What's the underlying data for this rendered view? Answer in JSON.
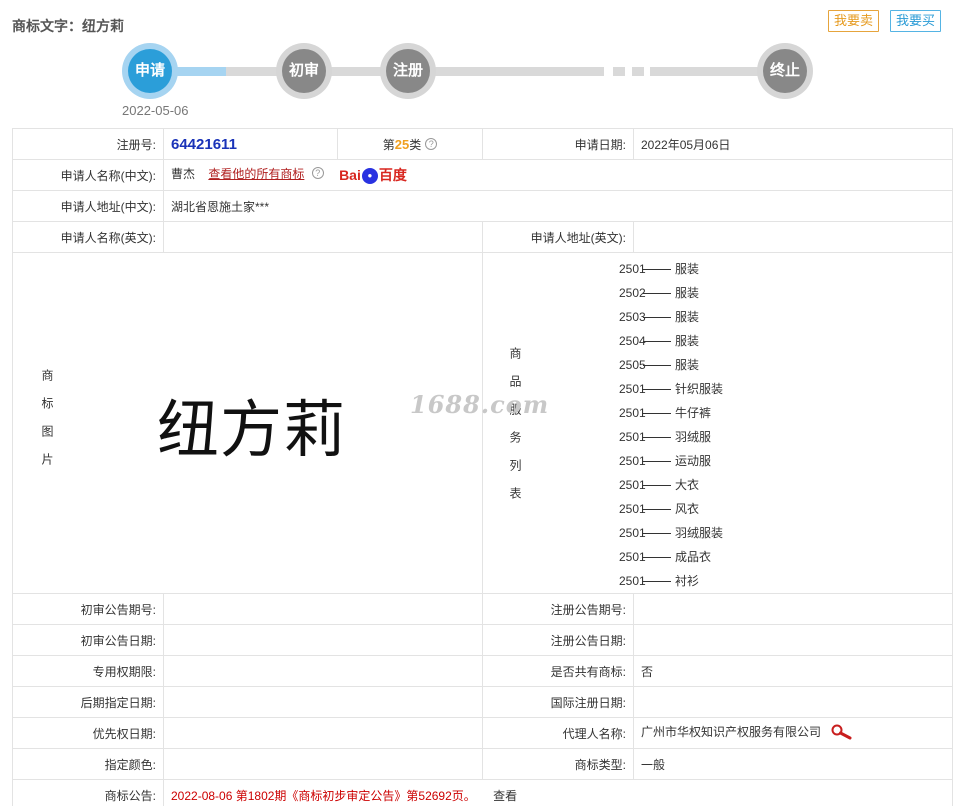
{
  "header": {
    "title": "商标文字：纽方莉",
    "sell_button": "我要卖",
    "buy_button": "我要买"
  },
  "progress": {
    "steps": [
      "申请",
      "初审",
      "注册",
      "终止"
    ],
    "active_step": 0,
    "apply_date": "2022-05-06",
    "colors": {
      "active": "#2b9ed9",
      "inactive": "#888888",
      "active_track": "#a6d4f1"
    }
  },
  "table": {
    "reg_no_label": "注册号:",
    "reg_no": "64421611",
    "class_prefix": "第",
    "class_num": "25",
    "class_suffix": "类",
    "apply_date_label": "申请日期:",
    "apply_date": "2022年05月06日",
    "applicant_cn_label": "申请人名称(中文):",
    "applicant_cn": "曹杰",
    "all_marks_link": "查看他的所有商标",
    "baidu_logo": "Bai百度",
    "address_cn_label": "申请人地址(中文):",
    "address_cn": "湖北省恩施土家***",
    "applicant_en_label": "申请人名称(英文):",
    "applicant_en": "",
    "address_en_label": "申请人地址(英文):",
    "address_en": "",
    "mark_image_label": "商标图片",
    "mark_image_text": "纽方莉",
    "watermark": "1688.com",
    "services_label": "商品服务列表",
    "services": [
      {
        "code": "2501",
        "name": "服装"
      },
      {
        "code": "2502",
        "name": "服装"
      },
      {
        "code": "2503",
        "name": "服装"
      },
      {
        "code": "2504",
        "name": "服装"
      },
      {
        "code": "2505",
        "name": "服装"
      },
      {
        "code": "2501",
        "name": "针织服装"
      },
      {
        "code": "2501",
        "name": "牛仔裤"
      },
      {
        "code": "2501",
        "name": "羽绒服"
      },
      {
        "code": "2501",
        "name": "运动服"
      },
      {
        "code": "2501",
        "name": "大衣"
      },
      {
        "code": "2501",
        "name": "风衣"
      },
      {
        "code": "2501",
        "name": "羽绒服装"
      },
      {
        "code": "2501",
        "name": "成品衣"
      },
      {
        "code": "2501",
        "name": "衬衫"
      }
    ],
    "prelim_no_label": "初审公告期号:",
    "prelim_no": "",
    "reg_notice_no_label": "注册公告期号:",
    "reg_notice_no": "",
    "prelim_date_label": "初审公告日期:",
    "prelim_date": "",
    "reg_notice_date_label": "注册公告日期:",
    "reg_notice_date": "",
    "exclusive_period_label": "专用权期限:",
    "exclusive_period": "",
    "shared_label": "是否共有商标:",
    "shared": "否",
    "later_date_label": "后期指定日期:",
    "later_date": "",
    "intl_date_label": "国际注册日期:",
    "intl_date": "",
    "priority_label": "优先权日期:",
    "priority": "",
    "agent_label": "代理人名称:",
    "agent": "广州市华权知识产权服务有限公司",
    "color_label": "指定颜色:",
    "color": "",
    "mark_type_label": "商标类型:",
    "mark_type": "一般",
    "notice_label": "商标公告:",
    "notice": "2022-08-06 第1802期《商标初步审定公告》第52692页。",
    "notice_view": "查看"
  }
}
